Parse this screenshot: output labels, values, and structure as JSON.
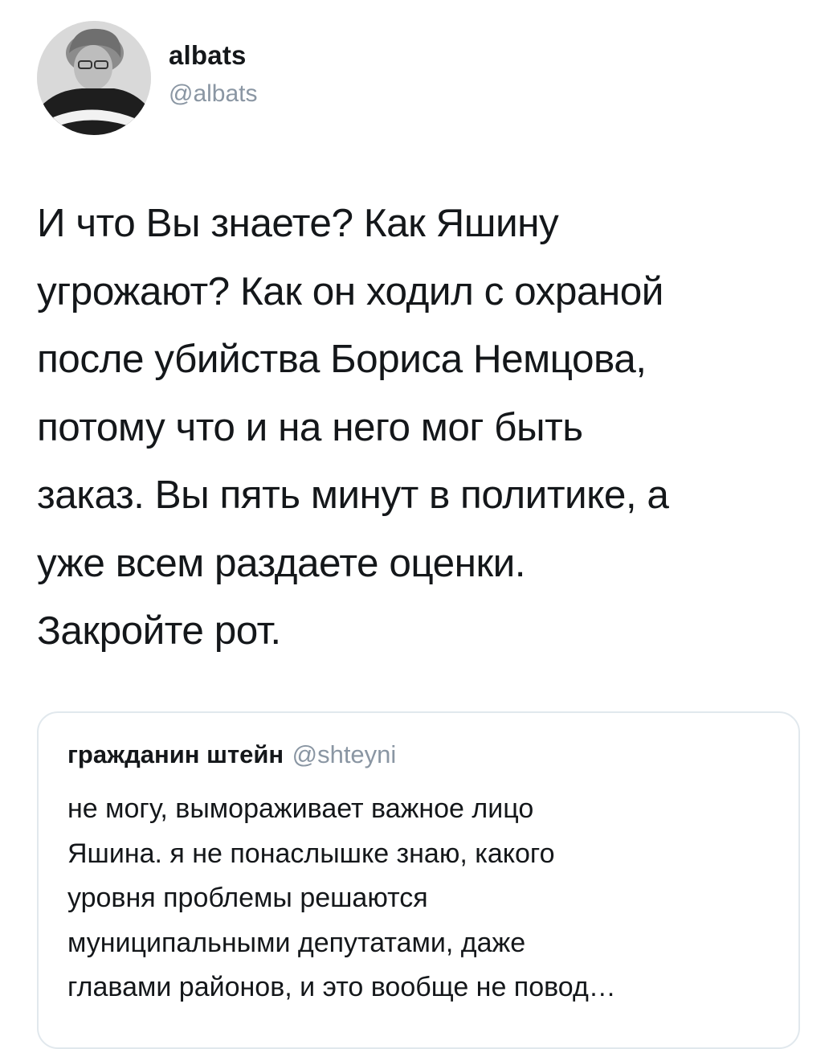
{
  "tweet": {
    "author": {
      "display_name": "albats",
      "handle": "@albats",
      "avatar": "avatar-photo"
    },
    "text": "И что Вы знаете? Как Яшину\nугрожают? Как он ходил с охраной\nпосле убийства Бориса Немцова,\nпотому что и на него мог быть\nзаказ. Вы пять минут в политике, а\nуже всем раздаете оценки.\nЗакройте рот."
  },
  "quoted_tweet": {
    "author": {
      "display_name": "гражданин штейн",
      "handle": "@shteyni"
    },
    "text": "не могу, вымораживает важное лицо\nЯшина. я не понаслышке знаю, какого\nуровня проблемы решаются\nмуниципальными депутатами, даже\nглавами районов, и это вообще не повод…"
  },
  "colors": {
    "text_primary": "#14171a",
    "text_secondary": "#8a96a3",
    "card_border": "#e1e8ed",
    "background": "#ffffff"
  }
}
